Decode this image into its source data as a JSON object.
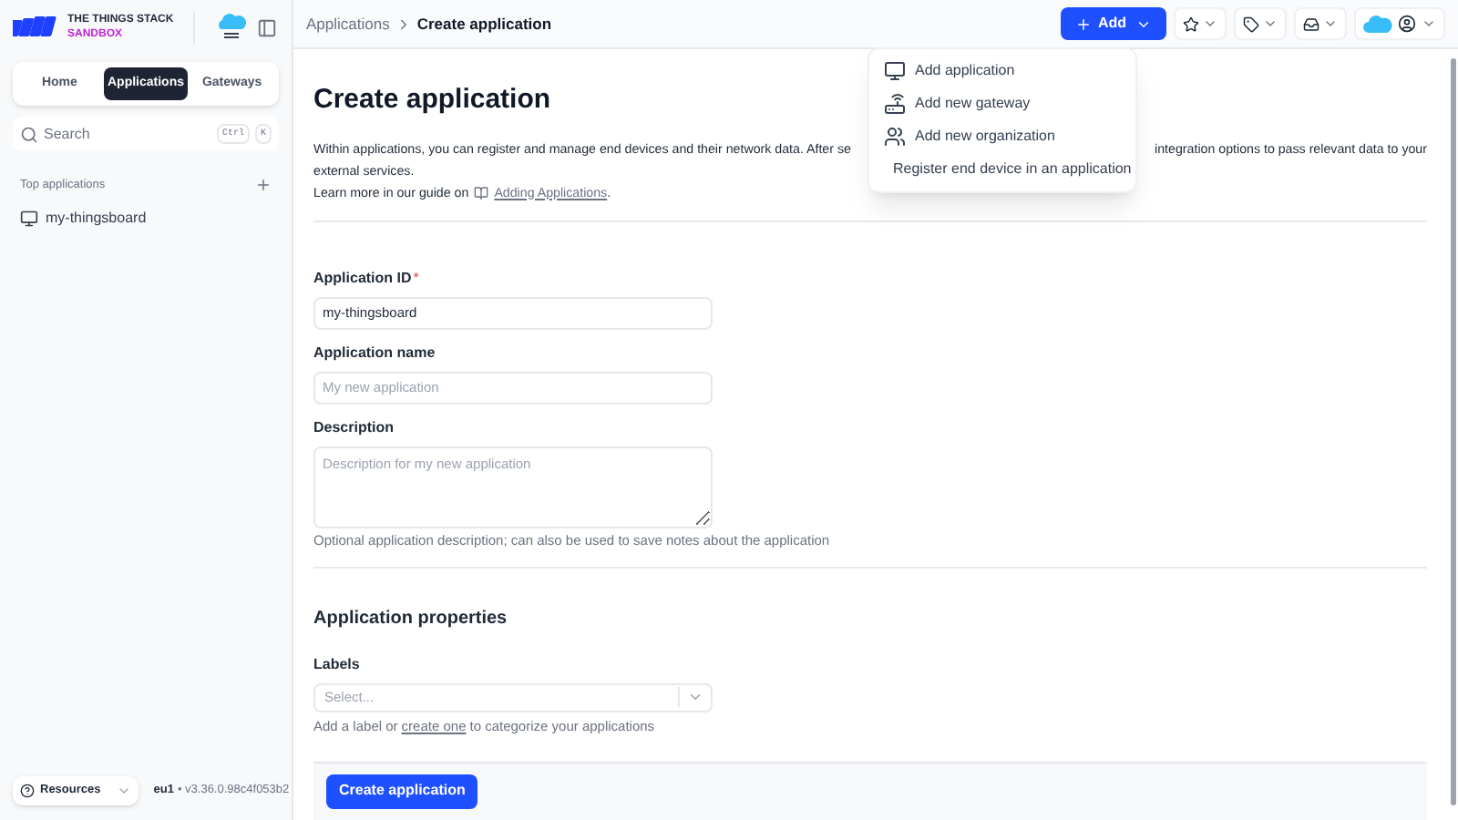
{
  "sidebar": {
    "logo": {
      "title": "THE THINGS STACK",
      "subtitle": "SANDBOX"
    },
    "tabs": [
      {
        "label": "Home",
        "selected": false
      },
      {
        "label": "Applications",
        "selected": true
      },
      {
        "label": "Gateways",
        "selected": false
      }
    ],
    "search": {
      "placeholder": "Search",
      "keys": [
        "Ctrl",
        "K"
      ]
    },
    "section_title": "Top applications",
    "items": [
      {
        "label": "my-thingsboard"
      }
    ],
    "footer": {
      "resources": "Resources",
      "cluster": "eu1",
      "version": "• v3.36.0.98c4f053b2"
    }
  },
  "breadcrumbs": [
    {
      "label": "Applications"
    },
    {
      "label": "Create application"
    }
  ],
  "header": {
    "add_button": "Add"
  },
  "add_menu": [
    {
      "kind": "application",
      "label": "Add application"
    },
    {
      "kind": "gateway",
      "label": "Add new gateway"
    },
    {
      "kind": "organization",
      "label": "Add new organization"
    },
    {
      "kind": "device",
      "label": "Register end device in an application"
    }
  ],
  "page": {
    "title": "Create application",
    "intro_start": "Within applications, you can register and manage end devices and their network data. After se",
    "intro_end": "integration options to pass relevant data to your",
    "intro_line2": "external services.",
    "guide_text": "Learn more in our guide on",
    "guide_link": "Adding Applications",
    "guide_end": "."
  },
  "fields": [
    {
      "kind": "input",
      "label": "Application ID",
      "required_mark": "*",
      "value": "my-thingsboard"
    },
    {
      "kind": "input",
      "label": "Application name",
      "placeholder": "My new application"
    },
    {
      "kind": "textarea",
      "label": "Description",
      "placeholder": "Description for my new application",
      "help": "Optional application description; can also be used to save notes about the application"
    }
  ],
  "properties": {
    "title": "Application properties",
    "label": "Labels",
    "placeholder": "Select...",
    "help_start": "Add a label or",
    "help_link": "create one",
    "help_end": "to categorize your applications"
  },
  "submit": "Create application"
}
